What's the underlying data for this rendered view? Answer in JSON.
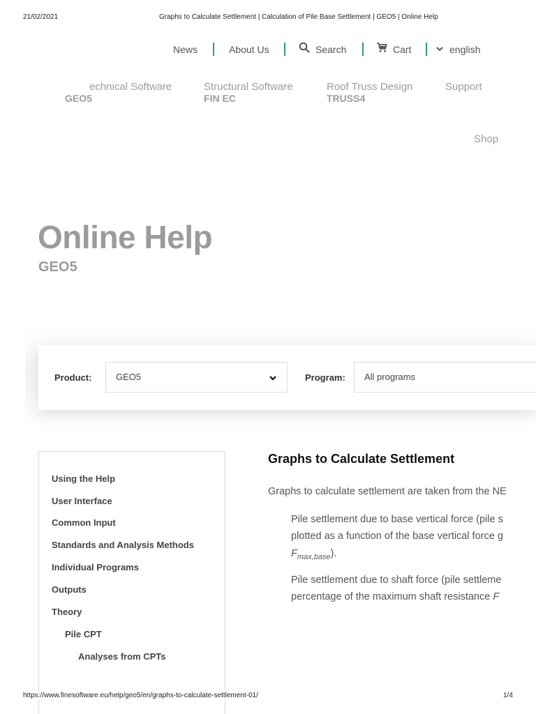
{
  "print": {
    "date": "21/02/2021",
    "page_title": "Graphs to Calculate Settlement | Calculation of Pile Base Settlement | GEO5 | Online Help",
    "url": "https://www.finesoftware.eu/help/geo5/en/graphs-to-calculate-settlement-01/",
    "page_count": "1/4"
  },
  "topnav": {
    "news": "News",
    "about": "About Us",
    "search": "Search",
    "cart": "Cart",
    "language": "english",
    "accent_color": "#2e9b78"
  },
  "product_menu": [
    {
      "label": "echnical Software",
      "sub": "GEO5"
    },
    {
      "label": "Structural Software",
      "sub": "FIN EC"
    },
    {
      "label": "Roof Truss Design",
      "sub": "TRUSS4"
    },
    {
      "label": "Support",
      "sub": ""
    }
  ],
  "shop": "Shop",
  "hero": {
    "title": "Online Help",
    "subtitle": "GEO5"
  },
  "filter": {
    "product_label": "Product:",
    "product_value": "GEO5",
    "program_label": "Program:",
    "program_value": "All programs"
  },
  "sidebar": {
    "items": [
      "Using the Help",
      "User Interface",
      "Common Input",
      "Standards and Analysis Methods",
      "Individual Programs",
      "Outputs",
      "Theory",
      "Pile CPT",
      "Analyses from CPTs"
    ]
  },
  "content": {
    "title": "Graphs to Calculate Settlement",
    "intro": "Graphs to calculate settlement are taken from the NE",
    "p1_line1": "Pile settlement due to base vertical force (pile s",
    "p1_line2": "plotted as a function of the base vertical force g",
    "p1_symbol": "F",
    "p1_subscript": "max,base",
    "p1_end": ").",
    "p2_line1": "Pile settlement due to shaft force (pile settleme",
    "p2_line2": "percentage of the maximum shaft resistance ",
    "p2_symbol": "F"
  }
}
